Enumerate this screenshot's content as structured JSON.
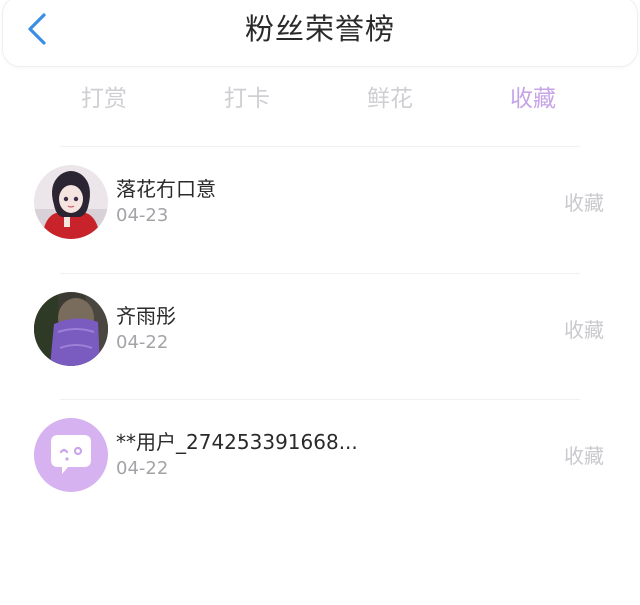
{
  "header": {
    "title": "粉丝荣誉榜",
    "back_icon": "chevron-left-icon",
    "accent_color": "#3a8ee6"
  },
  "tabs": [
    {
      "label": "打赏",
      "active": false
    },
    {
      "label": "打卡",
      "active": false
    },
    {
      "label": "鲜花",
      "active": false
    },
    {
      "label": "收藏",
      "active": true
    }
  ],
  "active_tab_color": "#c7a4e6",
  "rows": [
    {
      "name": "落花冇口意",
      "date": "04-23",
      "action": "收藏",
      "avatar": "anime-girl-avatar"
    },
    {
      "name": "齐雨彤",
      "date": "04-22",
      "action": "收藏",
      "avatar": "purple-veil-avatar"
    },
    {
      "name": "**用户_274253391668...",
      "date": "04-22",
      "action": "收藏",
      "avatar": "chat-bubble-avatar"
    }
  ]
}
